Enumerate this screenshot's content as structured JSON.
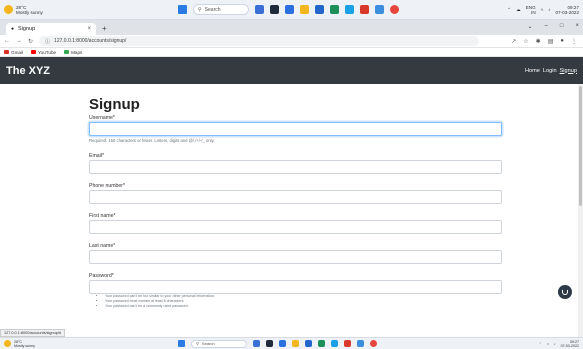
{
  "taskbar_top": {
    "weather_temp": "28°C",
    "weather_desc": "Mostly sunny",
    "search_placeholder": "Search",
    "lang_line1": "ENG",
    "lang_line2": "IN",
    "time": "09:27",
    "date": "07-03-2022"
  },
  "browser": {
    "tab_title": "Signup",
    "url": "127.0.0.1:8000/accounts/signup/",
    "bookmarks": [
      {
        "label": "Gmail",
        "color": "#d93025"
      },
      {
        "label": "YouTube",
        "color": "#ff0000"
      },
      {
        "label": "Maps",
        "color": "#34a853"
      }
    ]
  },
  "navbar": {
    "brand": "The XYZ",
    "links": [
      "Home",
      "Login",
      "Signup"
    ],
    "bg": "#343a40"
  },
  "form": {
    "title": "Signup",
    "fields": [
      {
        "label": "Username*",
        "help": "Required. 150 characters or fewer. Letters, digits and @/./+/-/_ only."
      },
      {
        "label": "Email*"
      },
      {
        "label": "Phone number*"
      },
      {
        "label": "First name*"
      },
      {
        "label": "Last name*"
      },
      {
        "label": "Password*"
      }
    ],
    "password_help": [
      "Your password can't be too similar to your other personal information.",
      "Your password must contain at least 8 characters.",
      "Your password can't be a commonly used password."
    ]
  },
  "status_url": "127.0.0.1:8000/accounts/signup/#",
  "taskbar_bottom": {
    "weather_temp": "28°C",
    "weather_desc": "Mostly sunny",
    "search_placeholder": "Search",
    "time": "09:27",
    "date": "07-03-2022"
  }
}
